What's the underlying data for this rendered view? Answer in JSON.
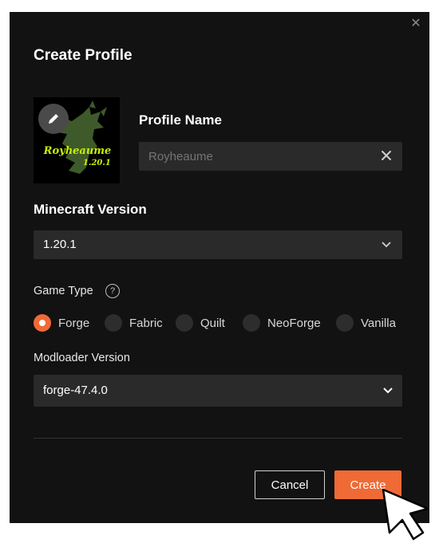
{
  "dialog": {
    "title": "Create Profile",
    "close_icon": "close-icon"
  },
  "thumbnail": {
    "name_text": "Royheaume",
    "version_text": "1.20.1",
    "edit_icon": "pencil-icon",
    "text_color": "#c7f000"
  },
  "profile_name": {
    "label": "Profile Name",
    "placeholder": "Royheaume",
    "clear_icon": "clear-icon"
  },
  "minecraft_version": {
    "label": "Minecraft Version",
    "value": "1.20.1"
  },
  "game_type": {
    "label": "Game Type",
    "help_icon": "?",
    "options": [
      "Forge",
      "Fabric",
      "Quilt",
      "NeoForge",
      "Vanilla"
    ],
    "selected": "Forge"
  },
  "modloader_version": {
    "label": "Modloader Version",
    "value": "forge-47.4.0"
  },
  "actions": {
    "cancel_label": "Cancel",
    "create_label": "Create"
  },
  "colors": {
    "accent": "#f06a35",
    "background": "#121212",
    "field": "#2a2a2a"
  }
}
